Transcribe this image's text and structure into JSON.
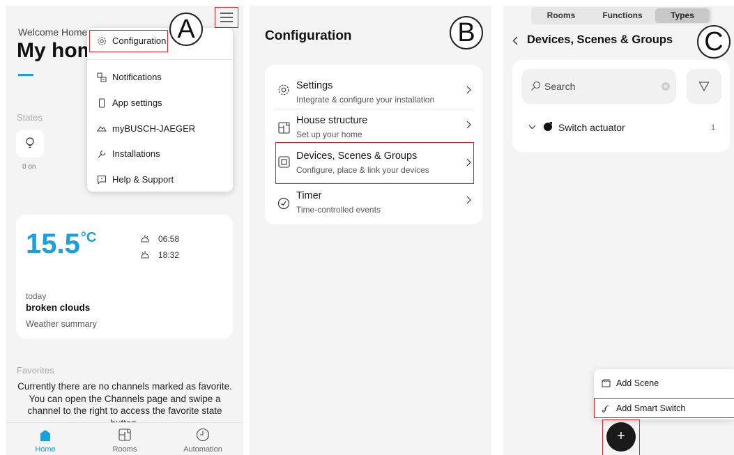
{
  "panel_a": {
    "label": "A",
    "welcome": "Welcome Home",
    "title": "My home",
    "states_label": "States",
    "states_value": "0 on",
    "menu": {
      "items": [
        {
          "label": "Configuration",
          "icon": "gear-icon"
        },
        {
          "label": "Notifications",
          "icon": "notification-icon"
        },
        {
          "label": "App settings",
          "icon": "phone-icon"
        },
        {
          "label": "myBUSCH-JAEGER",
          "icon": "cloud-icon"
        },
        {
          "label": "Installations",
          "icon": "wrench-icon"
        },
        {
          "label": "Help & Support",
          "icon": "help-icon"
        }
      ]
    },
    "weather": {
      "temperature": "15.5",
      "unit": "°C",
      "sunrise": "06:58",
      "sunset": "18:32",
      "day": "today",
      "condition": "broken clouds",
      "summary": "Weather summary"
    },
    "favorites_label": "Favorites",
    "favorites_text": "Currently there are no channels marked as favorite. You can open the Channels page and swipe a channel to the right to access the favorite state button.",
    "tabs": [
      {
        "label": "Home",
        "icon": "home-icon",
        "active": true
      },
      {
        "label": "Rooms",
        "icon": "rooms-icon",
        "active": false
      },
      {
        "label": "Automation",
        "icon": "clock-icon",
        "active": false
      }
    ]
  },
  "panel_b": {
    "label": "B",
    "title": "Configuration",
    "items": [
      {
        "title": "Settings",
        "subtitle": "Integrate & configure your installation",
        "icon": "gear-icon"
      },
      {
        "title": "House structure",
        "subtitle": "Set up your home",
        "icon": "floorplan-icon"
      },
      {
        "title": "Devices, Scenes & Groups",
        "subtitle": "Configure, place & link your devices",
        "icon": "device-icon"
      },
      {
        "title": "Timer",
        "subtitle": "Time-controlled events",
        "icon": "timer-icon"
      }
    ]
  },
  "panel_c": {
    "label": "C",
    "segments": [
      {
        "label": "Rooms",
        "active": false
      },
      {
        "label": "Functions",
        "active": false
      },
      {
        "label": "Types",
        "active": true
      }
    ],
    "title": "Devices, Scenes & Groups",
    "search_placeholder": "Search",
    "group": {
      "label": "Switch actuator",
      "count": "1"
    },
    "fab_menu": [
      {
        "label": "Add Scene",
        "icon": "scene-icon"
      },
      {
        "label": "Add Smart Switch",
        "icon": "smart-switch-icon"
      }
    ],
    "fab_symbol": "+"
  },
  "colors": {
    "accent": "#1aa0dc",
    "highlight": "#e0202a",
    "background": "#f4f4f4",
    "card": "#ffffff"
  }
}
